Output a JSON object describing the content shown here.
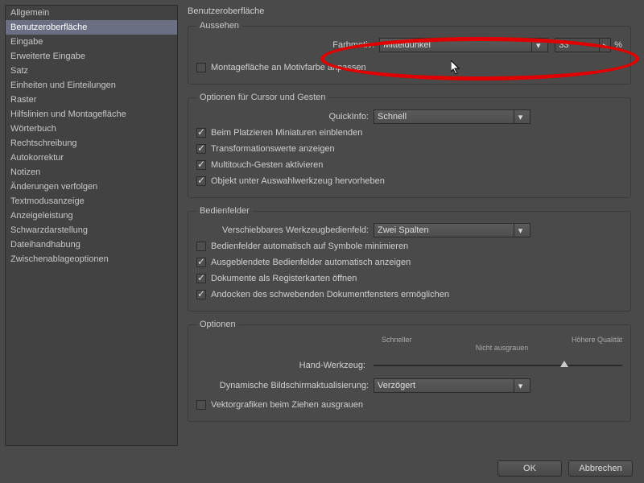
{
  "sidebar": {
    "items": [
      "Allgemein",
      "Benutzeroberfläche",
      "Eingabe",
      "Erweiterte Eingabe",
      "Satz",
      "Einheiten und Einteilungen",
      "Raster",
      "Hilfslinien und Montagefläche",
      "Wörterbuch",
      "Rechtschreibung",
      "Autokorrektur",
      "Notizen",
      "Änderungen verfolgen",
      "Textmodusanzeige",
      "Anzeigeleistung",
      "Schwarzdarstellung",
      "Dateihandhabung",
      "Zwischenablageoptionen"
    ],
    "selected_index": 1
  },
  "main": {
    "title": "Benutzeroberfläche",
    "appearance": {
      "legend": "Aussehen",
      "color_label": "Farbmotiv:",
      "color_value": "Mitteldunkel",
      "brightness_value": "33",
      "percent_symbol": "%",
      "match_pasteboard_label": "Montagefläche an Motivfarbe anpassen",
      "match_pasteboard_checked": false
    },
    "cursor": {
      "legend": "Optionen für Cursor und Gesten",
      "quickinfo_label": "QuickInfo:",
      "quickinfo_value": "Schnell",
      "items": [
        {
          "label": "Beim Platzieren Miniaturen einblenden",
          "checked": true
        },
        {
          "label": "Transformationswerte anzeigen",
          "checked": true
        },
        {
          "label": "Multitouch-Gesten aktivieren",
          "checked": true
        },
        {
          "label": "Objekt unter Auswahlwerkzeug hervorheben",
          "checked": true
        }
      ]
    },
    "panels": {
      "legend": "Bedienfelder",
      "toolpanel_label": "Verschiebbares Werkzeugbedienfeld:",
      "toolpanel_value": "Zwei Spalten",
      "items": [
        {
          "label": "Bedienfelder automatisch auf Symbole minimieren",
          "checked": false
        },
        {
          "label": "Ausgeblendete Bedienfelder automatisch anzeigen",
          "checked": true
        },
        {
          "label": "Dokumente als Registerkarten öffnen",
          "checked": true
        },
        {
          "label": "Andocken des schwebenden Dokumentfensters ermöglichen",
          "checked": true
        }
      ]
    },
    "options": {
      "legend": "Optionen",
      "tick_left": "Schneller",
      "tick_right": "Höhere Qualität",
      "tick_center": "Nicht ausgrauen",
      "hand_label": "Hand-Werkzeug:",
      "hand_value_pct": 75,
      "redraw_label": "Dynamische Bildschirmaktualisierung:",
      "redraw_value": "Verzögert",
      "greek_label": "Vektorgrafiken beim Ziehen ausgrauen",
      "greek_checked": false
    }
  },
  "buttons": {
    "ok": "OK",
    "cancel": "Abbrechen"
  }
}
